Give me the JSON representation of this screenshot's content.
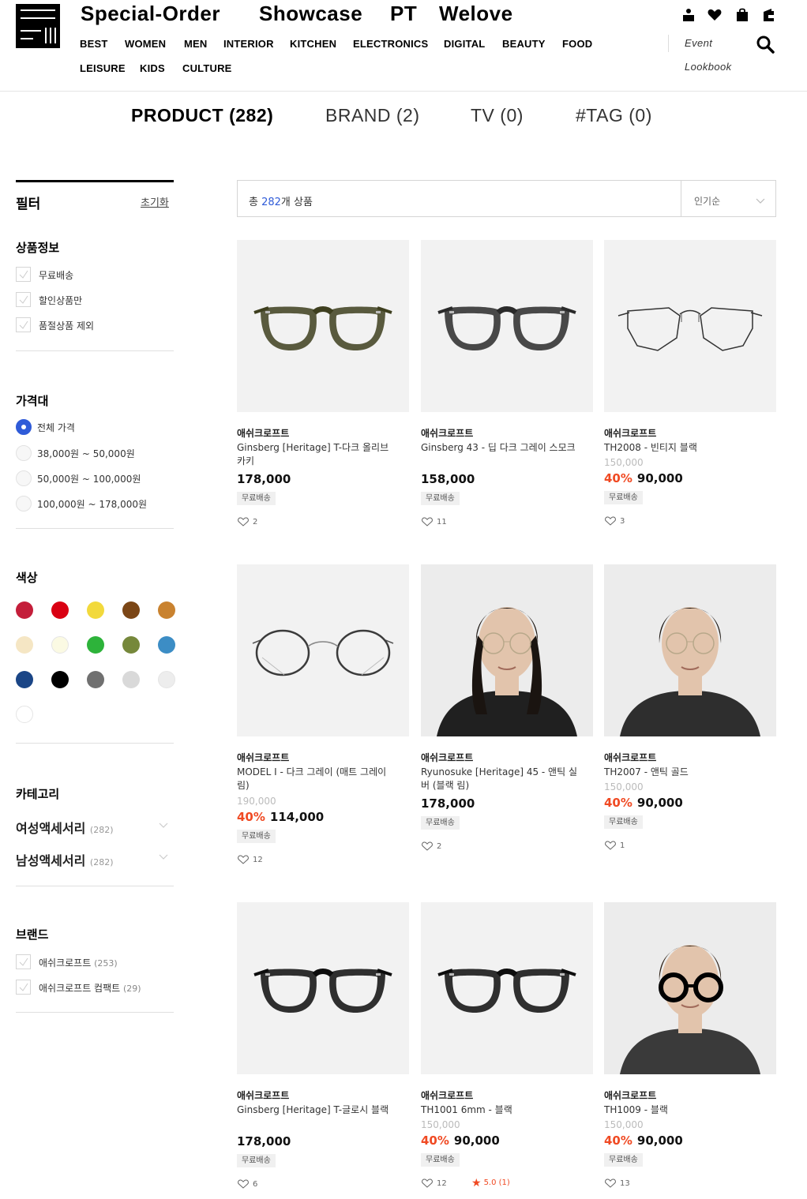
{
  "header": {
    "top_links": [
      "Special-Order",
      "Showcase",
      "PT",
      "Welove"
    ],
    "categories_row1": [
      "BEST",
      "WOMEN",
      "MEN",
      "INTERIOR",
      "KITCHEN",
      "ELECTRONICS",
      "DIGITAL",
      "BEAUTY",
      "FOOD"
    ],
    "categories_row2": [
      "LEISURE",
      "KIDS",
      "CULTURE"
    ],
    "side_links": [
      "Event",
      "Lookbook"
    ],
    "icons": [
      "user-icon",
      "heart-icon",
      "bag-icon",
      "wallet-icon",
      "search-icon"
    ]
  },
  "tabs": [
    {
      "label": "PRODUCT (282)",
      "active": true
    },
    {
      "label": "BRAND (2)",
      "active": false
    },
    {
      "label": "TV (0)",
      "active": false
    },
    {
      "label": "#TAG (0)",
      "active": false
    }
  ],
  "filter": {
    "title": "필터",
    "reset": "초기화",
    "product_info": {
      "title": "상품정보",
      "options": [
        "무료배송",
        "할인상품만",
        "품절상품 제외"
      ]
    },
    "price": {
      "title": "가격대",
      "options": [
        "전체 가격",
        "38,000원 ~ 50,000원",
        "50,000원 ~ 100,000원",
        "100,000원 ~ 178,000원"
      ],
      "selected_index": 0
    },
    "color": {
      "title": "색상",
      "swatches": [
        "#c41e3a",
        "#d90012",
        "#f2d93c",
        "#7b4616",
        "#c9822f",
        "#f5e6c4",
        "#fbfae3",
        "#2db33a",
        "#76883b",
        "#3c8dc5",
        "#1a4586",
        "#000000",
        "#707070",
        "#d9d9d9",
        "#ededed",
        "#ffffff"
      ]
    },
    "category": {
      "title": "카테고리",
      "items": [
        {
          "label": "여성액세서리",
          "count": "(282)"
        },
        {
          "label": "남성액세서리",
          "count": "(282)"
        }
      ]
    },
    "brand": {
      "title": "브랜드",
      "items": [
        {
          "label": "애쉬크로프트",
          "count": "(253)"
        },
        {
          "label": "애쉬크로프트 컴팩트",
          "count": "(29)"
        }
      ]
    }
  },
  "toolbar": {
    "total_prefix": "총 ",
    "total_count": "282",
    "total_suffix": "개 상품",
    "sort": "인기순"
  },
  "products": [
    {
      "brand": "애쉬크로프트",
      "name": "Ginsberg [Heritage] T-다크 올리브 카키",
      "original": "",
      "discount": "",
      "price": "178,000",
      "badge": "무료배송",
      "likes": "2",
      "rating": "",
      "image": "olive-frame"
    },
    {
      "brand": "애쉬크로프트",
      "name": "Ginsberg 43 - 딥 다크 그레이 스모크",
      "original": "",
      "discount": "",
      "price": "158,000",
      "badge": "무료배송",
      "likes": "11",
      "rating": "",
      "image": "dark-grey-frame"
    },
    {
      "brand": "애쉬크로프트",
      "name": "TH2008 - 빈티지 블랙",
      "original": "150,000",
      "discount": "40%",
      "price": "90,000",
      "badge": "무료배송",
      "likes": "3",
      "rating": "",
      "image": "thin-metal-frame"
    },
    {
      "brand": "애쉬크로프트",
      "name": "MODEL I - 다크 그레이 (매트 그레이 림)",
      "original": "190,000",
      "discount": "40%",
      "price": "114,000",
      "badge": "무료배송",
      "likes": "12",
      "rating": "",
      "image": "round-metal-frame"
    },
    {
      "brand": "애쉬크로프트",
      "name": "Ryunosuke [Heritage] 45 - 앤틱 실버 (블랙 림)",
      "original": "",
      "discount": "",
      "price": "178,000",
      "badge": "무료배송",
      "likes": "2",
      "rating": "",
      "image": "model-photo"
    },
    {
      "brand": "애쉬크로프트",
      "name": "TH2007 - 앤틱 골드",
      "original": "150,000",
      "discount": "40%",
      "price": "90,000",
      "badge": "무료배송",
      "likes": "1",
      "rating": "",
      "image": "model-photo"
    },
    {
      "brand": "애쉬크로프트",
      "name": "Ginsberg [Heritage] T-글로시 블랙",
      "original": "",
      "discount": "",
      "price": "178,000",
      "badge": "무료배송",
      "likes": "6",
      "rating": "",
      "image": "black-frame"
    },
    {
      "brand": "애쉬크로프트",
      "name": "TH1001 6mm - 블랙",
      "original": "150,000",
      "discount": "40%",
      "price": "90,000",
      "badge": "무료배송",
      "likes": "12",
      "rating": "5.0 (1)",
      "image": "black-frame"
    },
    {
      "brand": "애쉬크로프트",
      "name": "TH1009 - 블랙",
      "original": "150,000",
      "discount": "40%",
      "price": "90,000",
      "badge": "무료배송",
      "likes": "13",
      "rating": "",
      "image": "model-photo"
    }
  ]
}
